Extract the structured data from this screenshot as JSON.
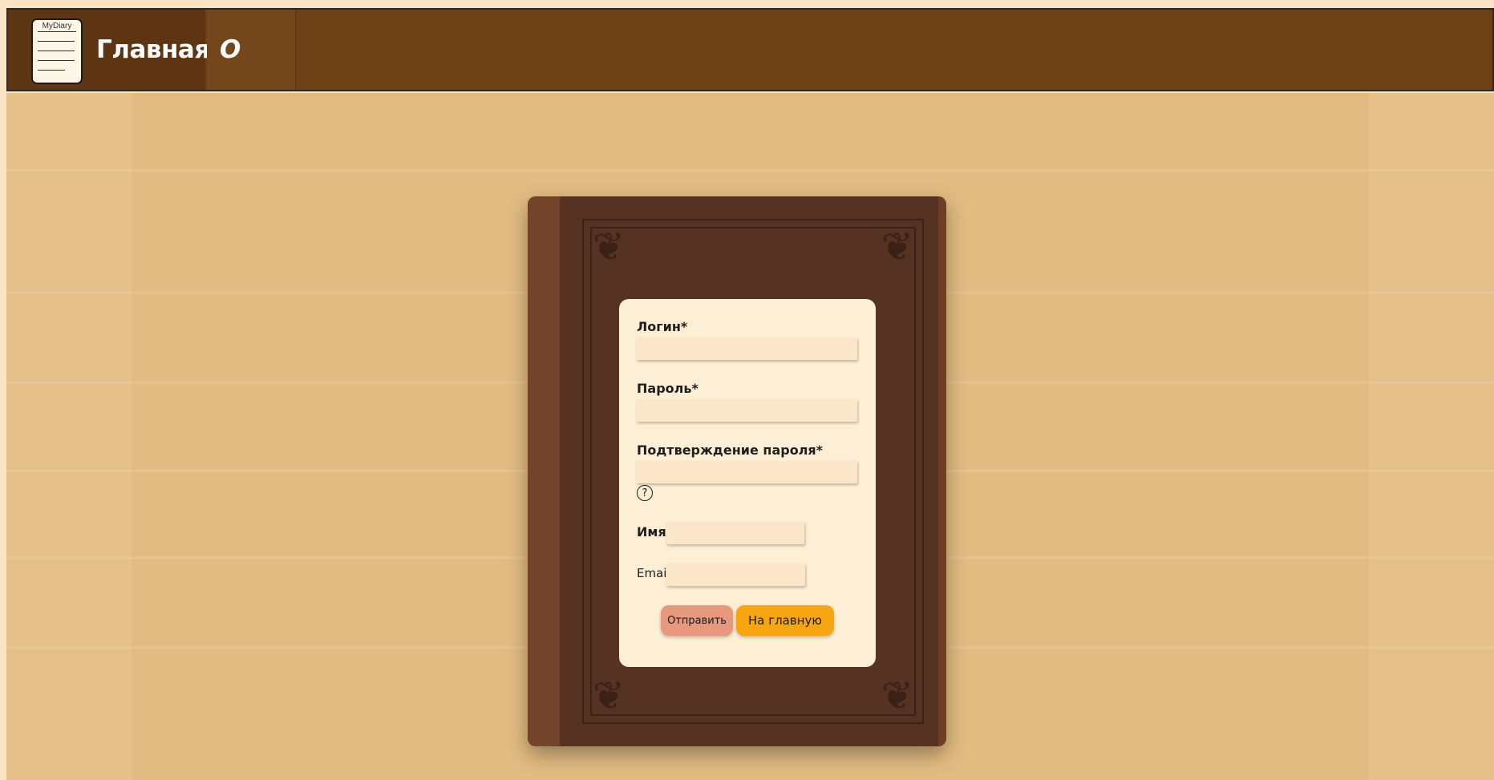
{
  "navbar": {
    "logo_text": "MyDiary",
    "home_label": "Главная",
    "about_label": "О нас"
  },
  "form": {
    "login_label": "Логин*",
    "password_label": "Пароль*",
    "confirm_label": "Подтверждение пароля*",
    "help_symbol": "?",
    "name_label": "Имя",
    "email_label": "Email",
    "submit_label": "Отправить",
    "home_button_label": "На главную",
    "login_value": "",
    "password_value": "",
    "confirm_value": "",
    "name_value": "",
    "email_value": ""
  },
  "colors": {
    "navbar": "#6e4015",
    "card": "#fdefd5",
    "submit": "#e8987c",
    "home_button": "#f7a611"
  }
}
